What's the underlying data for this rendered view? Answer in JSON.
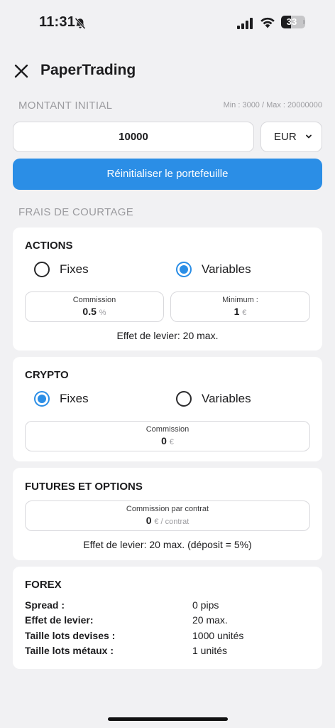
{
  "status_bar": {
    "time": "11:31",
    "battery": "33"
  },
  "header": {
    "title": "PaperTrading"
  },
  "initial_amount": {
    "section_label": "MONTANT INITIAL",
    "range": "Min : 3000 / Max : 20000000",
    "value": "10000",
    "currency": "EUR"
  },
  "reset_button": "Réinitialiser le portefeuille",
  "fees_section_label": "FRAIS DE COURTAGE",
  "actions": {
    "title": "ACTIONS",
    "option_fixed": "Fixes",
    "option_variable": "Variables",
    "commission_label": "Commission",
    "commission_value": "0.5",
    "commission_unit": "%",
    "minimum_label": "Minimum :",
    "minimum_value": "1",
    "minimum_unit": "€",
    "leverage": "Effet de levier: 20 max."
  },
  "crypto": {
    "title": "CRYPTO",
    "option_fixed": "Fixes",
    "option_variable": "Variables",
    "commission_label": "Commission",
    "commission_value": "0",
    "commission_unit": "€"
  },
  "futures": {
    "title": "FUTURES ET OPTIONS",
    "commission_label": "Commission par contrat",
    "commission_value": "0",
    "commission_unit": "€ / contrat",
    "leverage": "Effet de levier: 20 max. (déposit = 5%)"
  },
  "forex": {
    "title": "FOREX",
    "rows": [
      {
        "key": "Spread :",
        "value": "0 pips"
      },
      {
        "key": "Effet de levier:",
        "value": "20 max."
      },
      {
        "key": "Taille lots devises :",
        "value": "1000 unités"
      },
      {
        "key": "Taille lots métaux :",
        "value": "1 unités"
      }
    ]
  }
}
